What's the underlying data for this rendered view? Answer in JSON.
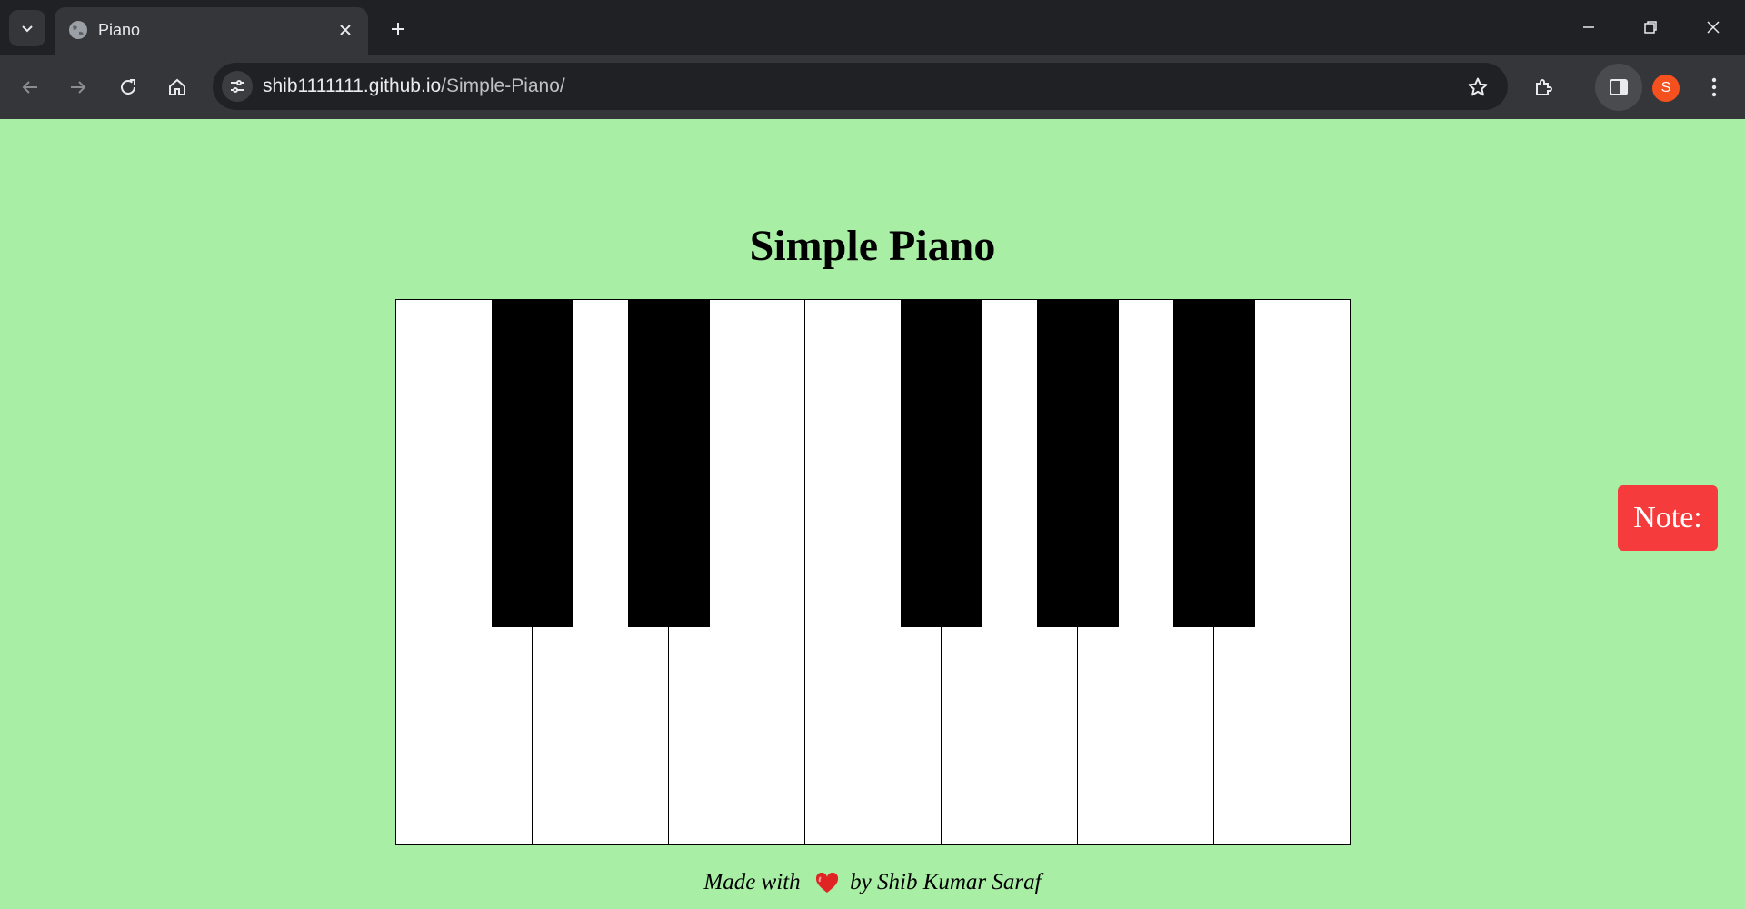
{
  "browser": {
    "tab_title": "Piano",
    "url_domain": "shib1111111.github.io",
    "url_path": "/Simple-Piano/",
    "profile_initial": "S",
    "profile_color": "#f4511e"
  },
  "page": {
    "background_color": "#a8eea5",
    "title": "Simple Piano",
    "note_label": "Note:",
    "note_color": "#f53b3b",
    "footer": {
      "prefix": "Made with",
      "heart_icon": "heart-icon",
      "suffix": "by Shib Kumar Saraf"
    }
  },
  "piano": {
    "white_key_count": 7,
    "black_key_count": 5
  }
}
